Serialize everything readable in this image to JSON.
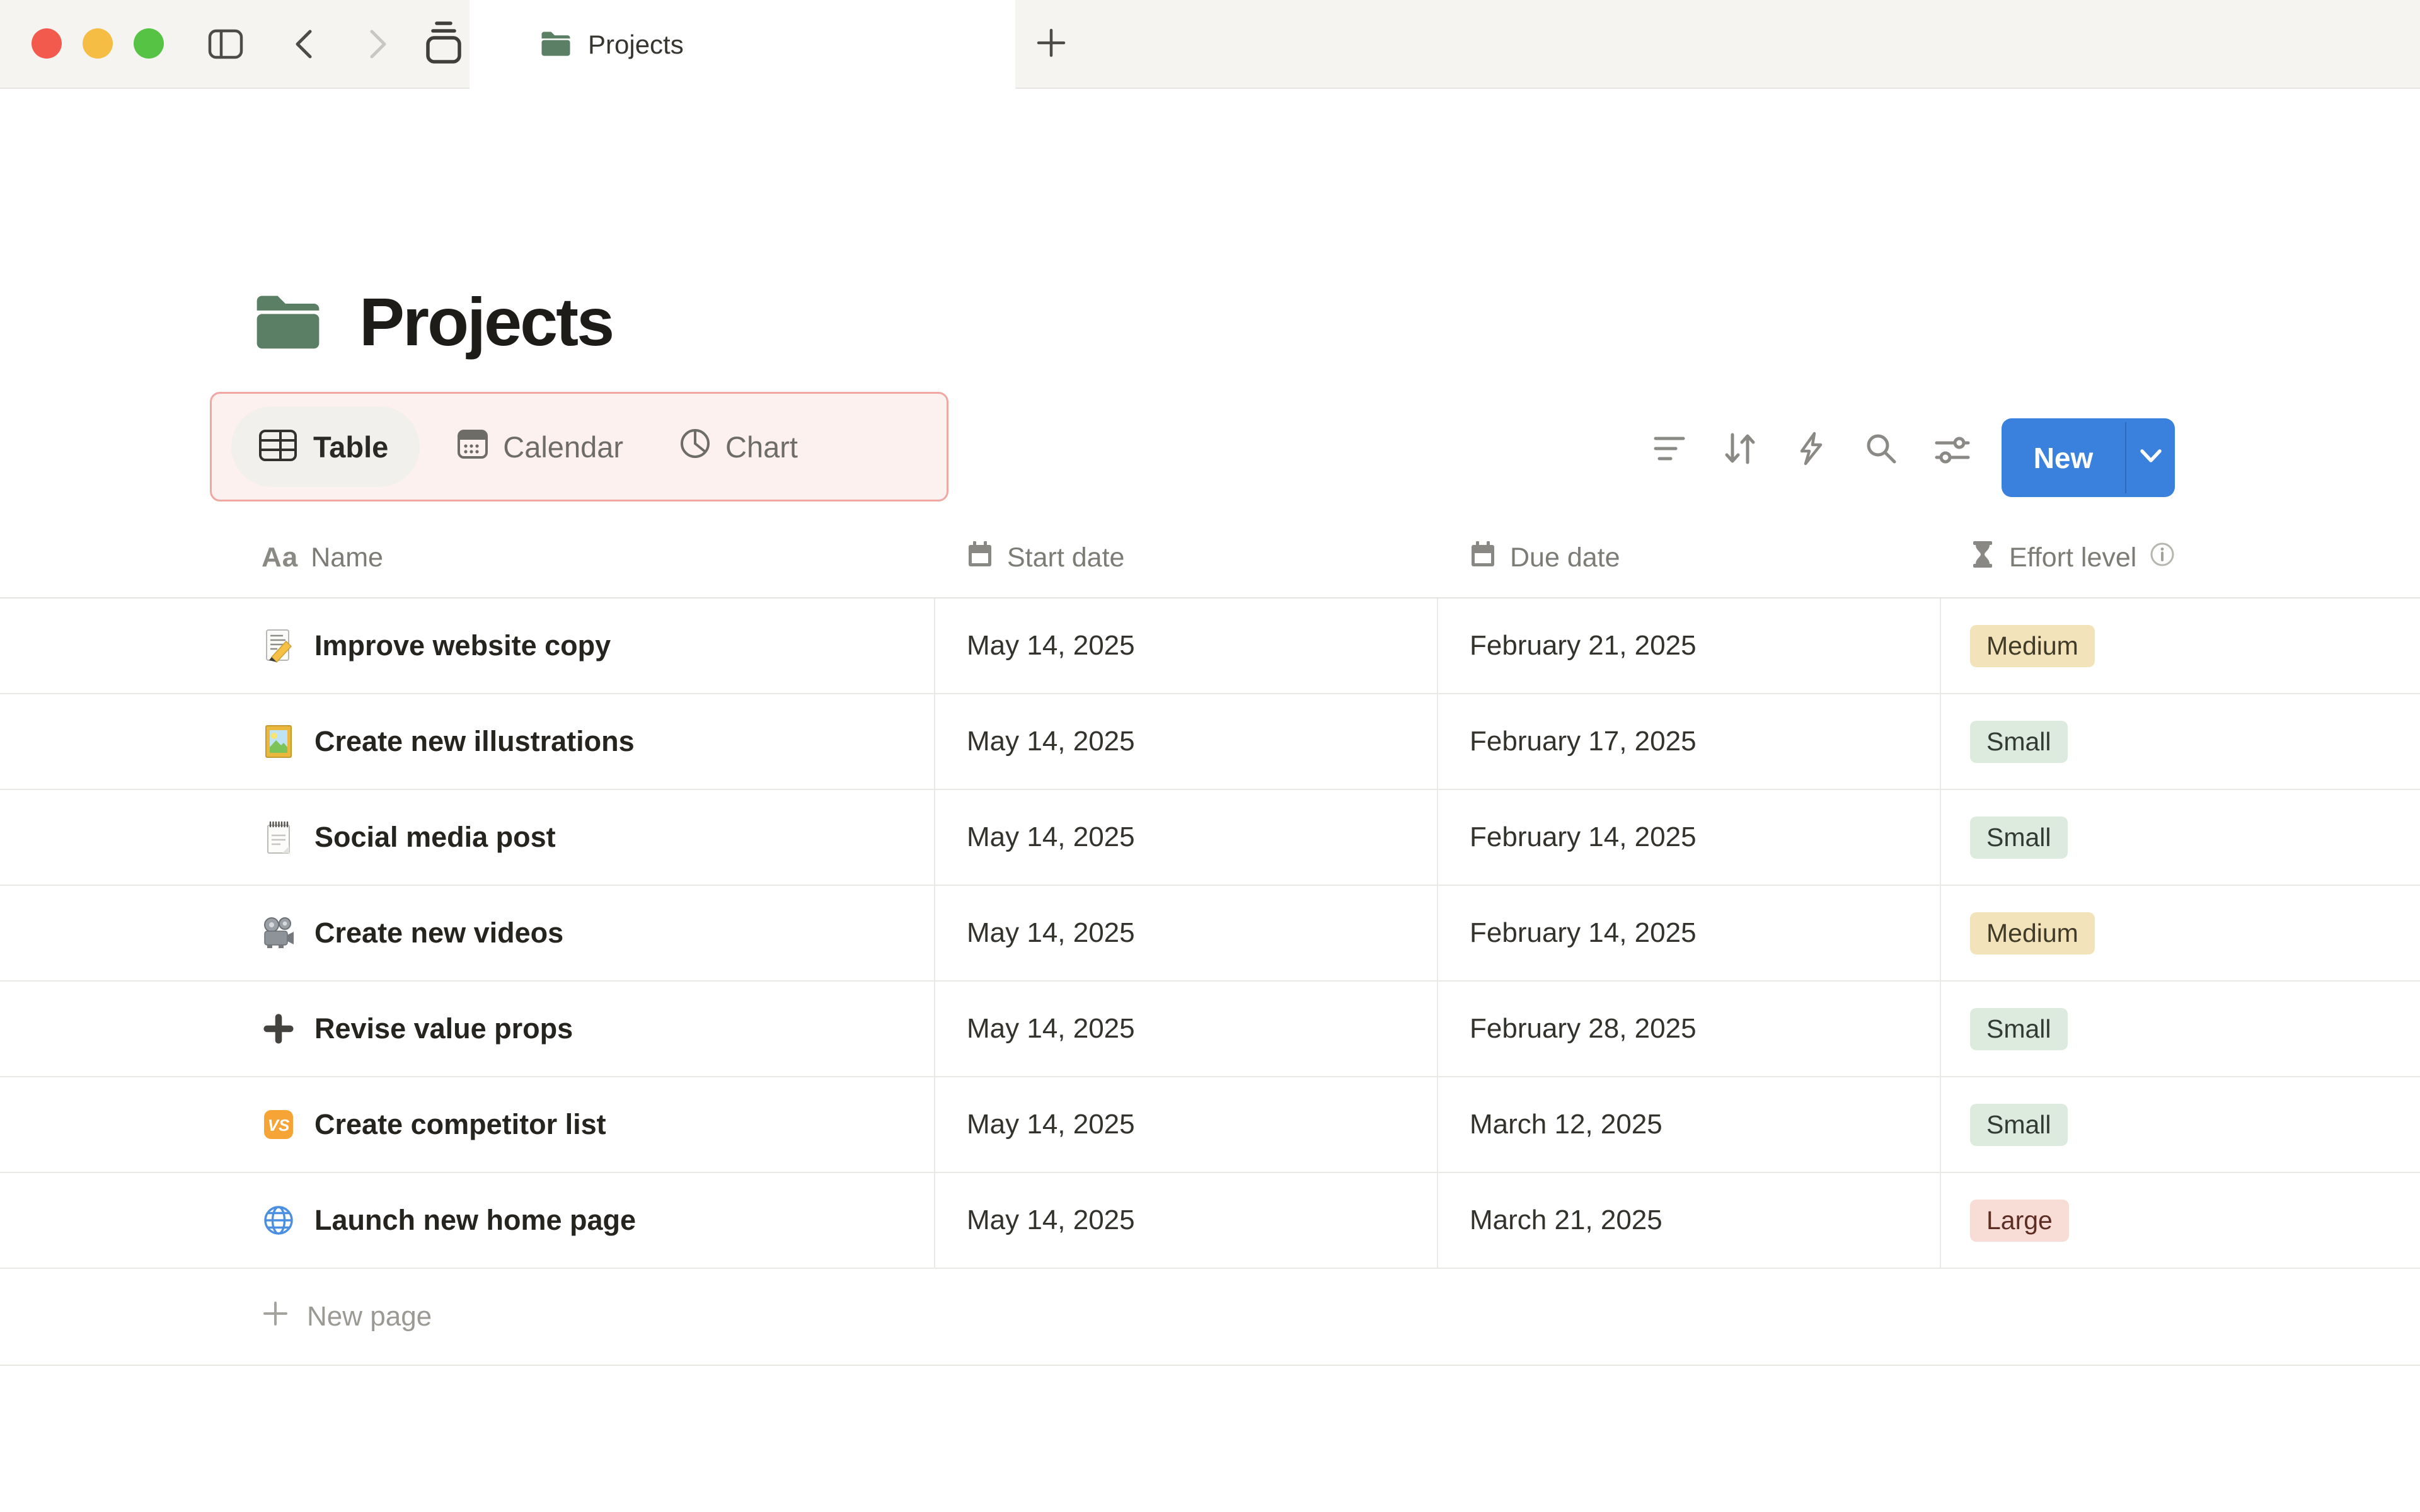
{
  "titlebar": {
    "tab_title": "Projects"
  },
  "page": {
    "title": "Projects",
    "icon": "green-folder"
  },
  "view_switcher": {
    "tabs": [
      {
        "label": "Table",
        "icon": "table-icon",
        "active": true
      },
      {
        "label": "Calendar",
        "icon": "calendar-icon",
        "active": false
      },
      {
        "label": "Chart",
        "icon": "pie-chart-icon",
        "active": false
      }
    ],
    "highlight_border_color": "#f0a7a2"
  },
  "actions": {
    "icons": [
      "filter",
      "sort",
      "automations",
      "search",
      "view-settings"
    ],
    "new_button": {
      "label": "New",
      "color": "#3a80dd"
    }
  },
  "table": {
    "columns": [
      {
        "label": "Name",
        "icon_glyph": "Aa"
      },
      {
        "label": "Start date",
        "icon": "calendar-icon"
      },
      {
        "label": "Due date",
        "icon": "calendar-icon"
      },
      {
        "label": "Effort level",
        "icon": "hourglass-icon",
        "has_info": true
      }
    ],
    "rows": [
      {
        "icon": "memo",
        "name": "Improve website copy",
        "start": "May 14, 2025",
        "due": "February 21, 2025",
        "effort": "Medium"
      },
      {
        "icon": "framed-picture",
        "name": "Create new illustrations",
        "start": "May 14, 2025",
        "due": "February 17, 2025",
        "effort": "Small"
      },
      {
        "icon": "notepad",
        "name": "Social media post",
        "start": "May 14, 2025",
        "due": "February 14, 2025",
        "effort": "Small"
      },
      {
        "icon": "movie-camera",
        "name": "Create new videos",
        "start": "May 14, 2025",
        "due": "February 14, 2025",
        "effort": "Medium"
      },
      {
        "icon": "plus",
        "name": "Revise value props",
        "start": "May 14, 2025",
        "due": "February 28, 2025",
        "effort": "Small"
      },
      {
        "icon": "vs",
        "name": "Create competitor list",
        "start": "May 14, 2025",
        "due": "March 12, 2025",
        "effort": "Small"
      },
      {
        "icon": "globe",
        "name": "Launch new home page",
        "start": "May 14, 2025",
        "due": "March 21, 2025",
        "effort": "Large"
      }
    ],
    "new_page_label": "New page"
  },
  "icons": {
    "vs_text": "VS"
  },
  "badge_colors": {
    "Medium": {
      "bg": "#f3e3bb",
      "text": "#403a29"
    },
    "Small": {
      "bg": "#dcebdd",
      "text": "#323a32"
    },
    "Large": {
      "bg": "#f8dcd6",
      "text": "#5e2d24"
    }
  }
}
